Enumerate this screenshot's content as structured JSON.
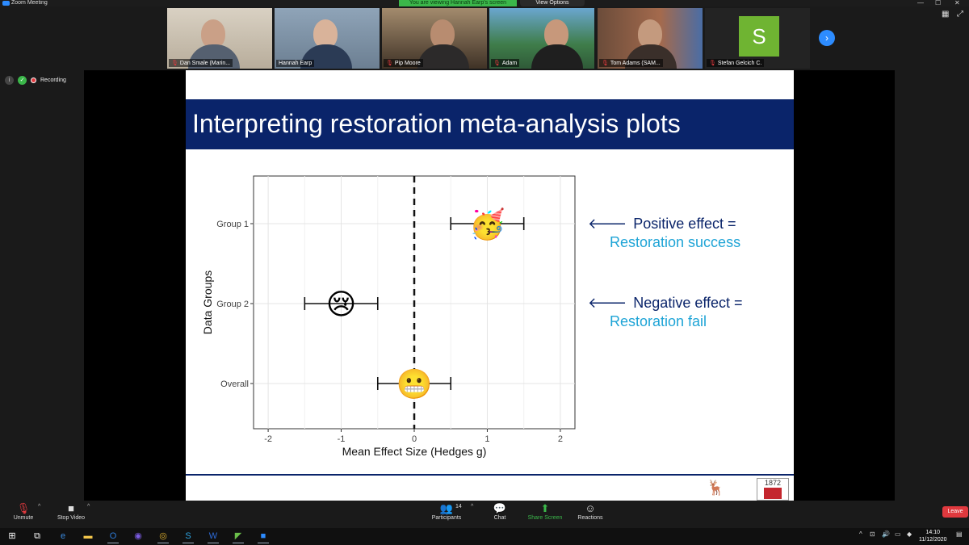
{
  "window": {
    "title": "Zoom Meeting",
    "viewing_banner": "You are viewing Hannah Earp's screen",
    "view_options": "View Options",
    "controls": [
      "—",
      "☐",
      "✕"
    ]
  },
  "participants": [
    {
      "name": "Dan Smale (Marin...",
      "muted": true
    },
    {
      "name": "Hannah Earp",
      "muted": false,
      "active": true
    },
    {
      "name": "Pip Moore",
      "muted": true
    },
    {
      "name": "Adam",
      "muted": true
    },
    {
      "name": "Tom Adams (SAM...",
      "muted": true
    },
    {
      "name": "Stefan Gelcich C.",
      "muted": true,
      "avatar_letter": "S"
    }
  ],
  "status": {
    "recording_label": "Recording",
    "info_icon": "info-icon",
    "security_icon": "shield-icon"
  },
  "slide": {
    "title": "Interpreting restoration meta-analysis plots",
    "annotations": [
      {
        "arrow": "🡐",
        "line1": "Positive effect =",
        "line2": "Restoration success"
      },
      {
        "arrow": "🡐",
        "line1": "Negative effect =",
        "line2": "Restoration fail"
      }
    ],
    "logo_year": "1872"
  },
  "chart_data": {
    "type": "forest",
    "categories": [
      "Group 1",
      "Group 2",
      "Overall"
    ],
    "estimates": [
      1.0,
      -1.0,
      0.0
    ],
    "ci_low": [
      0.5,
      -1.5,
      -0.5
    ],
    "ci_high": [
      1.5,
      -0.5,
      0.5
    ],
    "markers": [
      "party-face-emoji",
      "crying-face-emoji",
      "grimacing-face-emoji"
    ],
    "xlabel": "Mean Effect Size (Hedges g)",
    "ylabel": "Data Groups",
    "xlim": [
      -2.2,
      2.2
    ],
    "xticks": [
      -2,
      -1,
      0,
      1,
      2
    ],
    "reference_line": 0,
    "grid": true
  },
  "control_bar": {
    "unmute": "Unmute",
    "stop_video": "Stop Video",
    "participants": "Participants",
    "participants_count": "14",
    "chat": "Chat",
    "share_screen": "Share Screen",
    "reactions": "Reactions",
    "leave": "Leave"
  },
  "taskbar": {
    "time": "14:10",
    "date": "11/12/2020",
    "apps": [
      "windows-start-icon",
      "task-view-icon",
      "edge-icon",
      "file-explorer-icon",
      "outlook-icon",
      "firefox-icon",
      "chrome-icon",
      "skype-icon",
      "word-icon",
      "app-icon",
      "zoom-icon"
    ]
  }
}
